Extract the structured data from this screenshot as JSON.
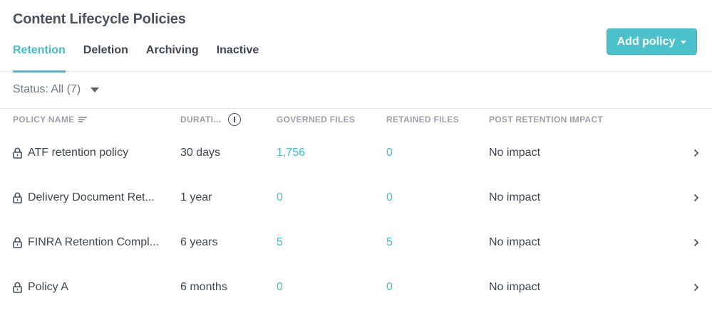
{
  "page": {
    "title": "Content Lifecycle Policies"
  },
  "tabs": [
    {
      "label": "Retention",
      "active": true
    },
    {
      "label": "Deletion",
      "active": false
    },
    {
      "label": "Archiving",
      "active": false
    },
    {
      "label": "Inactive",
      "active": false
    }
  ],
  "toolbar": {
    "add_policy_label": "Add policy"
  },
  "filter": {
    "status_label": "Status: All (7)"
  },
  "table": {
    "columns": {
      "policy_name": "POLICY NAME",
      "duration": "DURATI...",
      "governed_files": "GOVERNED FILES",
      "retained_files": "RETAINED FILES",
      "post_retention_impact": "POST RETENTION IMPACT"
    },
    "rows": [
      {
        "name": "ATF retention policy",
        "duration": "30 days",
        "governed": "1,756",
        "retained": "0",
        "impact": "No impact"
      },
      {
        "name": "Delivery Document Ret...",
        "duration": "1 year",
        "governed": "0",
        "retained": "0",
        "impact": "No impact"
      },
      {
        "name": "FINRA Retention Compl...",
        "duration": "6 years",
        "governed": "5",
        "retained": "5",
        "impact": "No impact"
      },
      {
        "name": "Policy A",
        "duration": "6 months",
        "governed": "0",
        "retained": "0",
        "impact": "No impact"
      }
    ]
  },
  "icons": {
    "info": "i",
    "lock": "lock-icon",
    "chevron": "chevron-right-icon",
    "sort": "sort-icon"
  },
  "colors": {
    "accent": "#3fbfc9",
    "button": "#4bc2cb"
  }
}
